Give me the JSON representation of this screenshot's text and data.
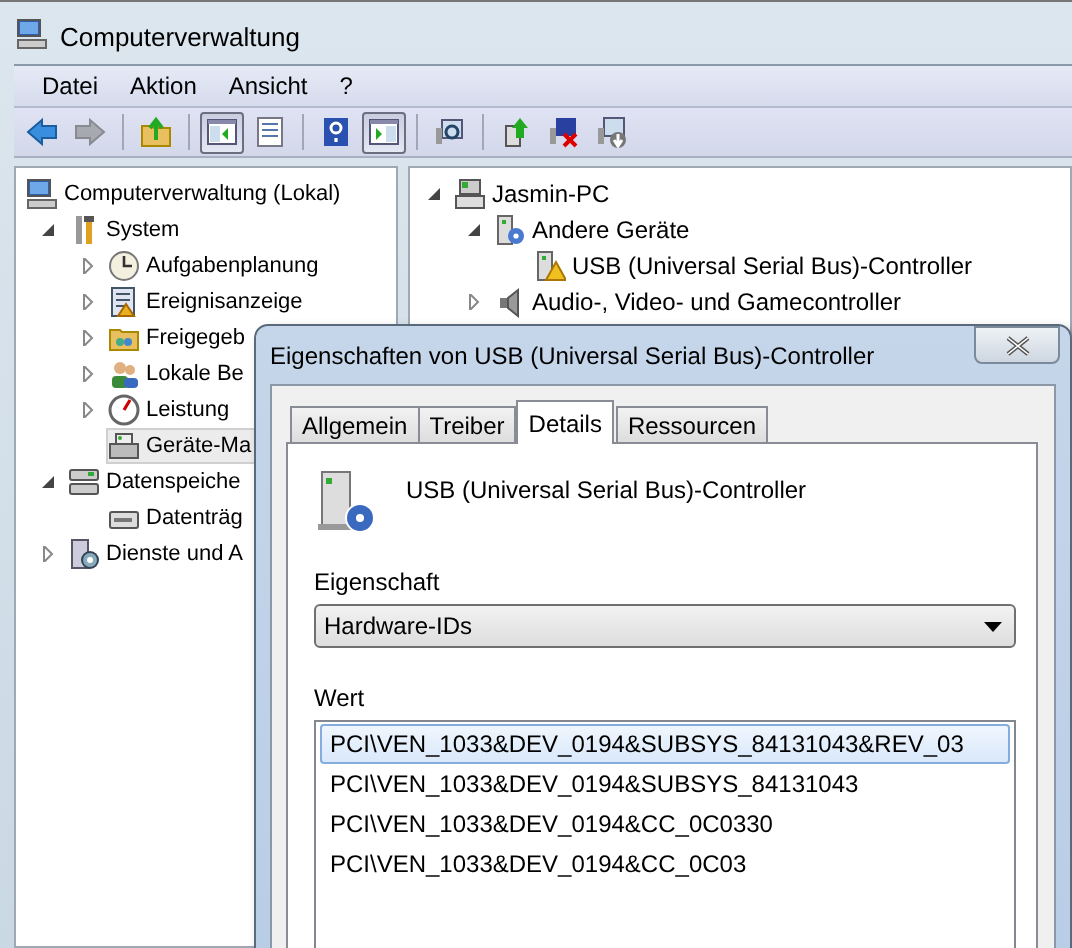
{
  "window": {
    "title": "Computerverwaltung"
  },
  "menu": [
    "Datei",
    "Aktion",
    "Ansicht",
    "?"
  ],
  "toolbar": [
    {
      "pressed": false,
      "disabled": false
    },
    {
      "pressed": false,
      "disabled": true
    },
    {
      "pressed": false,
      "disabled": false
    },
    {
      "pressed": true,
      "disabled": false
    },
    {
      "pressed": false,
      "disabled": false
    },
    {
      "pressed": false,
      "disabled": false
    },
    {
      "pressed": true,
      "disabled": false
    },
    {
      "pressed": false,
      "disabled": false
    },
    {
      "pressed": false,
      "disabled": false
    },
    {
      "pressed": false,
      "disabled": false
    },
    {
      "pressed": false,
      "disabled": false
    }
  ],
  "left_tree": [
    {
      "label": "Computerverwaltung (Lokal)",
      "selected": false,
      "children": [
        {
          "label": "System",
          "selected": false,
          "expanded": true,
          "children": [
            {
              "label": "Aufgabenplanung",
              "selected": false,
              "expanded": false
            },
            {
              "label": "Ereignisanzeige",
              "selected": false,
              "expanded": false
            },
            {
              "label": "Freigegeb",
              "selected": false,
              "expanded": false
            },
            {
              "label": "Lokale Be",
              "selected": false,
              "expanded": false
            },
            {
              "label": "Leistung",
              "selected": false,
              "expanded": false
            },
            {
              "label": "Geräte-Ma",
              "selected": true
            }
          ]
        },
        {
          "label": "Datenspeiche",
          "selected": false,
          "expanded": true,
          "children": [
            {
              "label": "Datenträg",
              "selected": false
            }
          ]
        },
        {
          "label": "Dienste und A",
          "selected": false,
          "expanded": false
        }
      ]
    }
  ],
  "right_tree": [
    {
      "label": "Jasmin-PC",
      "selected": false,
      "expanded": true,
      "children": [
        {
          "label": "Andere Geräte",
          "selected": false,
          "expanded": true,
          "children": [
            {
              "label": "USB (Universal Serial Bus)-Controller",
              "selected": false
            }
          ]
        },
        {
          "label": "Audio-, Video- und Gamecontroller",
          "selected": false,
          "expanded": false
        }
      ]
    }
  ],
  "dialog": {
    "title": "Eigenschaften von USB (Universal Serial Bus)-Controller",
    "tabs": [
      {
        "label": "Allgemein",
        "selected": false
      },
      {
        "label": "Treiber",
        "selected": false
      },
      {
        "label": "Details",
        "selected": true
      },
      {
        "label": "Ressourcen",
        "selected": false
      }
    ],
    "device_name": "USB (Universal Serial Bus)-Controller",
    "property_label": "Eigenschaft",
    "property_value": "Hardware-IDs",
    "value_label": "Wert",
    "values": [
      {
        "text": "PCI\\VEN_1033&DEV_0194&SUBSYS_84131043&REV_03",
        "selected": true
      },
      {
        "text": "PCI\\VEN_1033&DEV_0194&SUBSYS_84131043",
        "selected": false
      },
      {
        "text": "PCI\\VEN_1033&DEV_0194&CC_0C0330",
        "selected": false
      },
      {
        "text": "PCI\\VEN_1033&DEV_0194&CC_0C03",
        "selected": false
      }
    ]
  }
}
